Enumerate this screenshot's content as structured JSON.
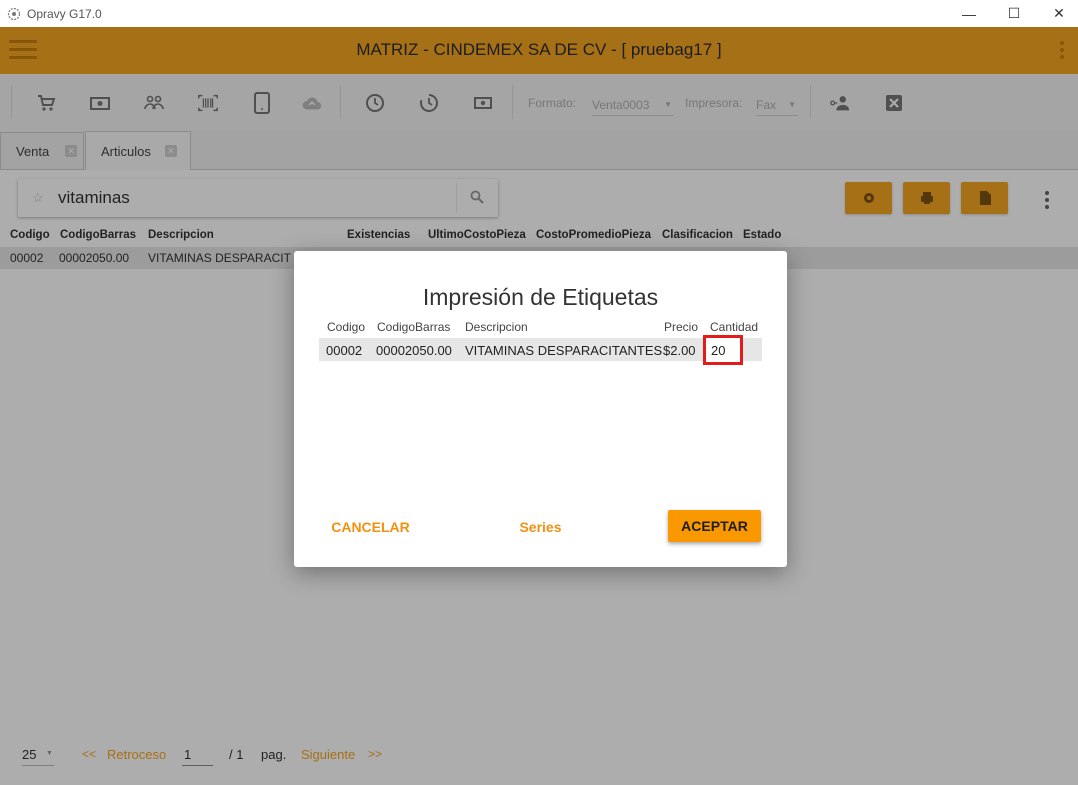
{
  "window": {
    "title": "Opravy G17.0",
    "minimize": "—",
    "maximize": "☐",
    "close": "✕"
  },
  "header": {
    "title": "MATRIZ - CINDEMEX SA DE CV - [ pruebag17 ]"
  },
  "toolbar": {
    "formato_label": "Formato:",
    "formato_value": "Venta0003",
    "impresora_label": "Impresora:",
    "impresora_value": "Fax"
  },
  "tabs": [
    {
      "label": "Venta",
      "active": false
    },
    {
      "label": "Articulos",
      "active": true
    }
  ],
  "search": {
    "value": "vitaminas"
  },
  "grid": {
    "columns": [
      "Codigo",
      "CodigoBarras",
      "Descripcion",
      "Existencias",
      "UltimoCostoPieza",
      "CostoPromedioPieza",
      "Clasificacion",
      "Estado"
    ],
    "rows": [
      {
        "codigo": "00002",
        "codigobarras": "00002050.00",
        "descripcion": "VITAMINAS DESPARACIT"
      }
    ]
  },
  "footer": {
    "page_size": "25",
    "prev_arrows": "<<",
    "prev_label": "Retroceso",
    "page_value": "1",
    "of_label": "/ 1",
    "pag_label": "pag.",
    "next_label": "Siguiente",
    "next_arrows": ">>"
  },
  "dialog": {
    "title": "Impresión de Etiquetas",
    "columns": [
      "Codigo",
      "CodigoBarras",
      "Descripcion",
      "Precio",
      "Cantidad"
    ],
    "row": {
      "codigo": "00002",
      "codigobarras": "00002050.00",
      "descripcion": "VITAMINAS DESPARACITANTES",
      "precio": "$2.00",
      "cantidad": "20"
    },
    "cancel_label": "CANCELAR",
    "series_label": "Series",
    "accept_label": "ACEPTAR"
  },
  "colors": {
    "accent": "#f5a623",
    "accent_text": "#f29111",
    "highlight": "#e21b1b"
  }
}
